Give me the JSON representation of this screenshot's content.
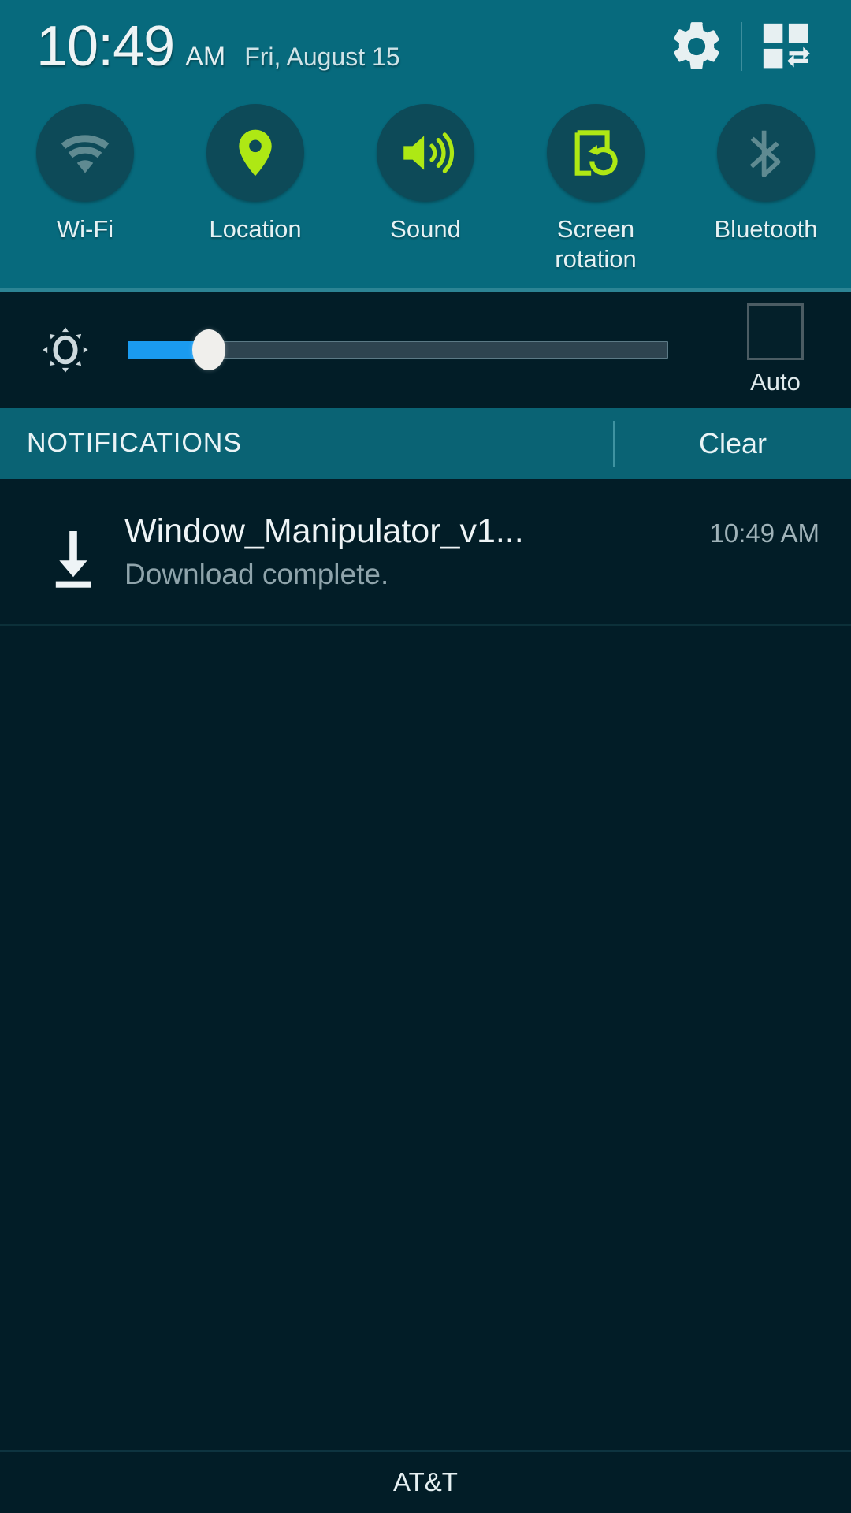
{
  "statusbar": {
    "time": "10:49",
    "ampm": "AM",
    "date": "Fri, August 15",
    "settings_icon": "gear-icon",
    "quick_toggle_icon": "quick-settings-grid-icon"
  },
  "quick_settings": {
    "toggles": [
      {
        "label": "Wi-Fi",
        "icon": "wifi-icon",
        "active": false
      },
      {
        "label": "Location",
        "icon": "location-pin-icon",
        "active": true
      },
      {
        "label": "Sound",
        "icon": "sound-speaker-icon",
        "active": true
      },
      {
        "label": "Screen\nrotation",
        "label_line1": "Screen",
        "label_line2": "rotation",
        "icon": "screen-rotation-icon",
        "active": true
      },
      {
        "label": "Bluetooth",
        "icon": "bluetooth-icon",
        "active": false
      }
    ]
  },
  "brightness": {
    "icon": "brightness-gear-icon",
    "value_percent": 15,
    "auto_label": "Auto",
    "auto_checked": false
  },
  "notifications_panel": {
    "header_label": "NOTIFICATIONS",
    "clear_label": "Clear",
    "items": [
      {
        "icon": "download-complete-icon",
        "title": "Window_Manipulator_v1...",
        "subtitle": "Download complete.",
        "time": "10:49 AM"
      }
    ]
  },
  "footer": {
    "carrier": "AT&T"
  },
  "colors": {
    "panel_teal": "#076a7d",
    "panel_dark": "#021d27",
    "toggle_circle": "#0d4a58",
    "accent_lime": "#aee814",
    "inactive_icon": "#5f8a91",
    "slider_fill": "#1a9bf0",
    "notif_header": "#0a6374"
  }
}
